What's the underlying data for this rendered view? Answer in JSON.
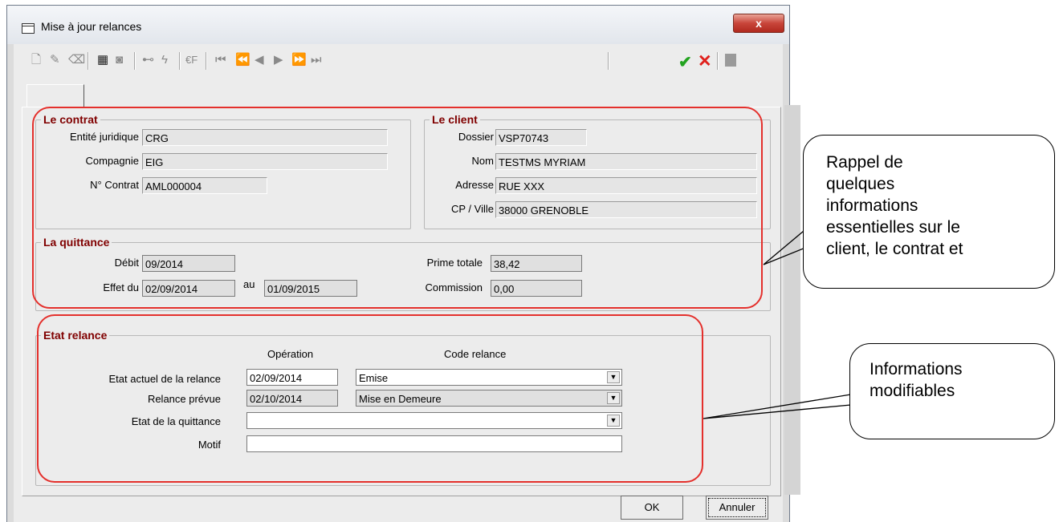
{
  "window": {
    "title": "Mise à jour relances",
    "close_label": "x"
  },
  "toolbar": {
    "icons": [
      "new-icon",
      "edit-icon",
      "erase-icon",
      "calendar-icon",
      "camera-icon",
      "binoculars-icon",
      "lightning-icon",
      "euro-icon",
      "first-icon",
      "prev-page-icon",
      "prev-icon",
      "next-icon",
      "next-page-icon",
      "last-icon",
      "validate-icon",
      "cancel-icon",
      "exit-icon"
    ],
    "euro_label": "€F"
  },
  "contrat": {
    "legend": "Le contrat",
    "entite_label": "Entité juridique",
    "entite_value": "CRG",
    "compagnie_label": "Compagnie",
    "compagnie_value": "EIG",
    "contrat_label": "N° Contrat",
    "contrat_value": "AML000004"
  },
  "client": {
    "legend": "Le client",
    "dossier_label": "Dossier",
    "dossier_value": "VSP70743",
    "nom_label": "Nom",
    "nom_value": "TESTMS MYRIAM",
    "adresse_label": "Adresse",
    "adresse_value": "RUE XXX",
    "ville_label": "CP / Ville",
    "ville_value": "38000 GRENOBLE"
  },
  "quittance": {
    "legend": "La quittance",
    "debit_label": "Débit",
    "debit_value": "09/2014",
    "effet_label": "Effet du",
    "effet_value": "02/09/2014",
    "au_label": "au",
    "au_value": "01/09/2015",
    "prime_label": "Prime totale",
    "prime_value": "38,42",
    "commission_label": "Commission",
    "commission_value": "0,00"
  },
  "relance": {
    "legend": "Etat relance",
    "operation_header": "Opération",
    "code_header": "Code relance",
    "etat_actuel_label": "Etat actuel de la relance",
    "etat_actuel_date": "02/09/2014",
    "etat_actuel_code": "Emise",
    "prevue_label": "Relance prévue",
    "prevue_date": "02/10/2014",
    "prevue_code": "Mise en Demeure",
    "quittance_label": "Etat de la quittance",
    "quittance_value": "",
    "motif_label": "Motif",
    "motif_value": ""
  },
  "buttons": {
    "ok": "OK",
    "annuler": "Annuler"
  },
  "callouts": {
    "rappel": [
      "Rappel de",
      "quelques",
      "informations",
      "essentielles sur le",
      "client, le contrat et"
    ],
    "modifiables": [
      "Informations",
      "modifiables"
    ]
  },
  "colors": {
    "legend": "#800000",
    "oval": "#e4302c",
    "validate": "#22a31f",
    "cancel": "#e0201c",
    "close": "#c8453a"
  }
}
